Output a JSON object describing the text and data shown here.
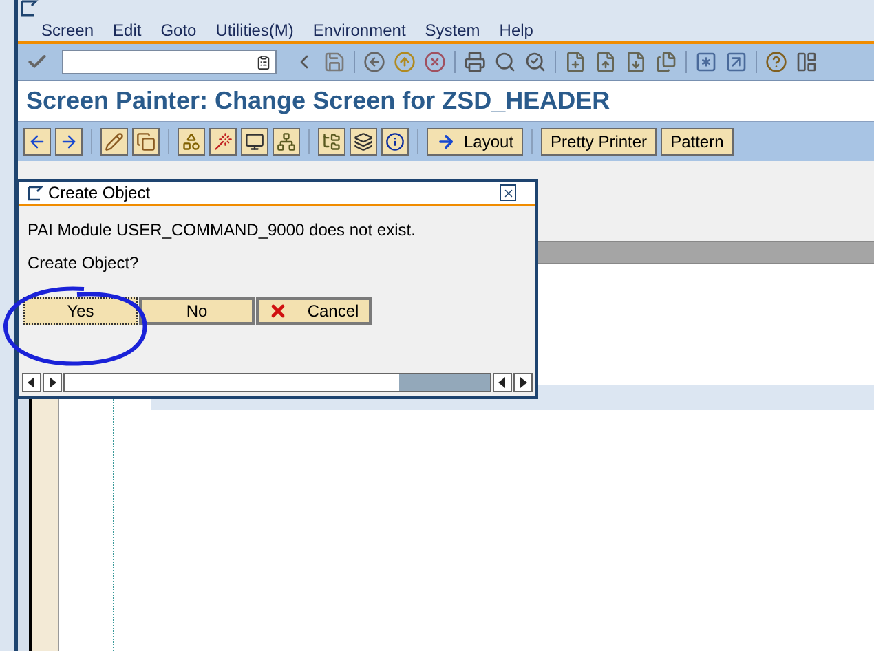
{
  "menu": [
    "Screen",
    "Edit",
    "Goto",
    "Utilities(M)",
    "Environment",
    "System",
    "Help"
  ],
  "title": "Screen Painter: Change Screen for ZSD_HEADER",
  "app_toolbar": [
    {
      "kind": "icon"
    },
    {
      "kind": "icon"
    },
    {
      "kind": "icon"
    },
    {
      "kind": "icon"
    },
    {
      "kind": "icon"
    },
    {
      "kind": "icon"
    },
    {
      "kind": "icon"
    },
    {
      "kind": "icon"
    },
    {
      "kind": "icon"
    },
    {
      "kind": "icon"
    },
    {
      "kind": "icon"
    },
    {
      "kind": "arrow",
      "label": "Layout"
    },
    {
      "kind": "text",
      "label": "Pretty Printer"
    },
    {
      "kind": "text",
      "label": "Pattern"
    }
  ],
  "dialog": {
    "title": "Create Object",
    "message": "PAI Module USER_COMMAND_9000 does not exist.",
    "question": "Create Object?",
    "buttons": [
      {
        "label": "Yes",
        "focused": true,
        "kind": "plain"
      },
      {
        "label": "No",
        "focused": false,
        "kind": "plain"
      },
      {
        "label": "Cancel",
        "focused": false,
        "kind": "cancel"
      }
    ]
  }
}
